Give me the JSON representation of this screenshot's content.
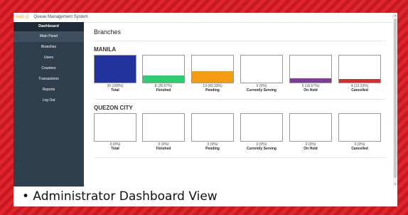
{
  "app": {
    "brand": "Auto Q",
    "title": "Queue Management System",
    "close_glyph": "×"
  },
  "sidebar": {
    "header": "Dashboard",
    "items": [
      {
        "label": "Main Panel",
        "active": true
      },
      {
        "label": "Branches"
      },
      {
        "label": "Users"
      },
      {
        "label": "Counters"
      },
      {
        "label": "Transactions"
      },
      {
        "label": "Reports"
      },
      {
        "label": "Log Out"
      }
    ]
  },
  "page": {
    "title": "Branches"
  },
  "branches": [
    {
      "name": "MANILA",
      "stats": [
        {
          "value": "30 (100%)",
          "label": "Total",
          "fraction": 1.0,
          "color": "#2233a0"
        },
        {
          "value": "8 (26.67%)",
          "label": "Finished",
          "fraction": 0.2667,
          "color": "#2ecc71"
        },
        {
          "value": "13 (43.33%)",
          "label": "Pending",
          "fraction": 0.4333,
          "color": "#f39c12"
        },
        {
          "value": "0 (0%)",
          "label": "Currently Serving",
          "fraction": 0,
          "color": "#3498db"
        },
        {
          "value": "5 (16.67%)",
          "label": "On Hold",
          "fraction": 0.1667,
          "color": "#7d3c98"
        },
        {
          "value": "4 (13.33%)",
          "label": "Cancelled",
          "fraction": 0.1333,
          "color": "#e02828"
        }
      ]
    },
    {
      "name": "QUEZON CITY",
      "stats": [
        {
          "value": "0 (0%)",
          "label": "Total",
          "fraction": 0,
          "color": "#2233a0"
        },
        {
          "value": "0 (0%)",
          "label": "Finished",
          "fraction": 0,
          "color": "#2ecc71"
        },
        {
          "value": "0 (0%)",
          "label": "Pending",
          "fraction": 0,
          "color": "#f39c12"
        },
        {
          "value": "0 (0%)",
          "label": "Currently Serving",
          "fraction": 0,
          "color": "#3498db"
        },
        {
          "value": "0 (0%)",
          "label": "On Hold",
          "fraction": 0,
          "color": "#7d3c98"
        },
        {
          "value": "0 (0%)",
          "label": "Cancelled",
          "fraction": 0,
          "color": "#e02828"
        }
      ]
    }
  ],
  "caption": "• Administrator Dashboard View"
}
